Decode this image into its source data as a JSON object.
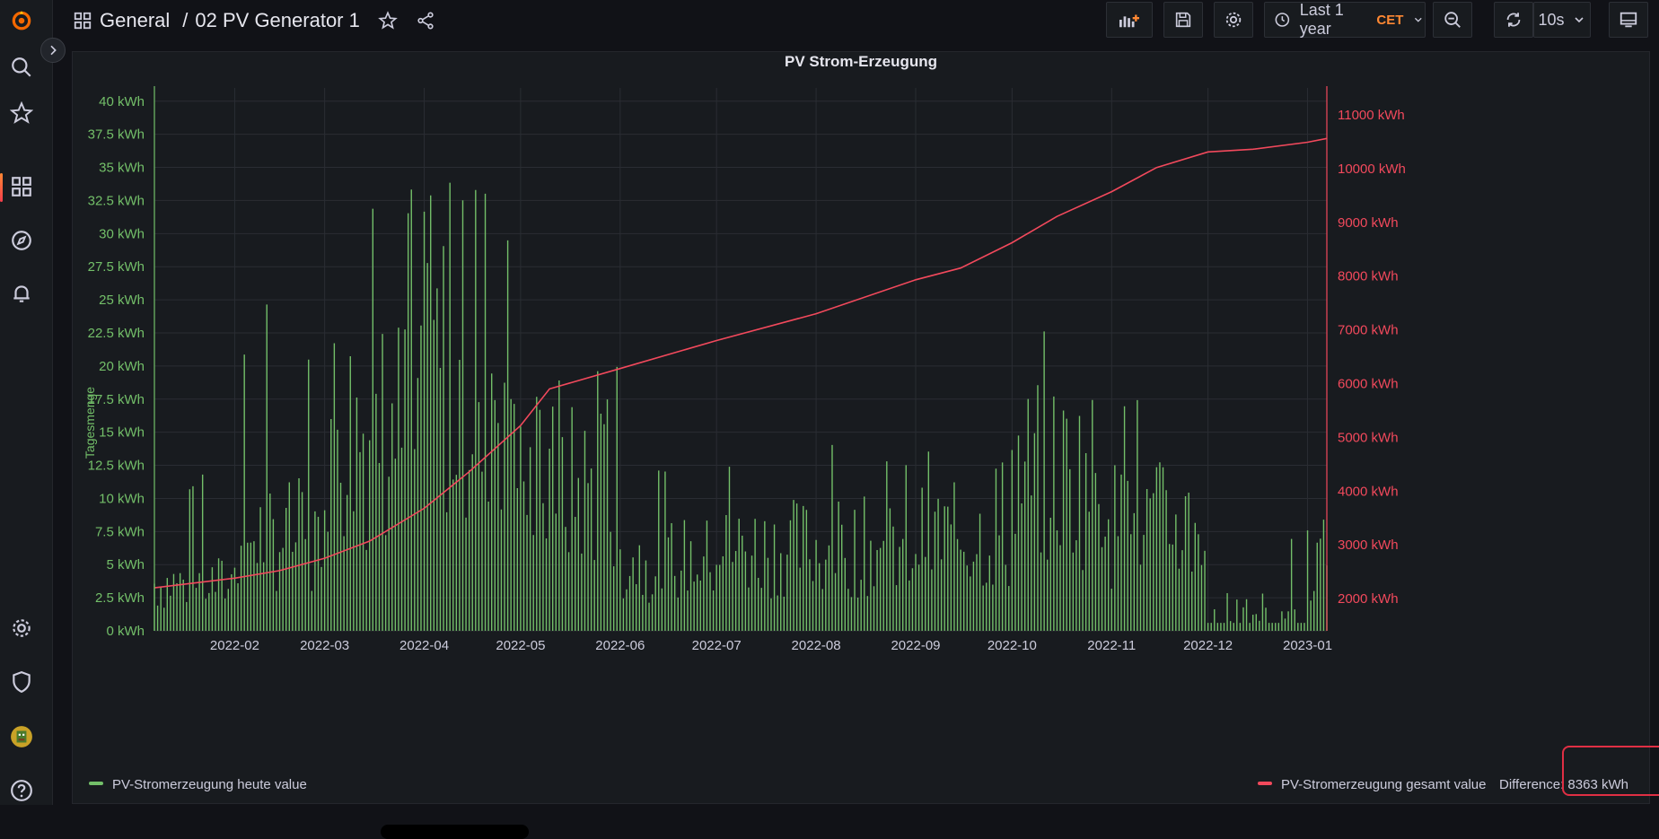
{
  "nav": {
    "breadcrumb_folder": "General",
    "breadcrumb_sep": "/",
    "dashboard_title": "02 PV Generator 1",
    "time_range": "Last 1 year",
    "timezone": "CET",
    "refresh_interval": "10s"
  },
  "panel": {
    "title": "PV Strom-Erzeugung",
    "difference_label": "Difference: 8363 kWh"
  },
  "colors": {
    "daily": "#73bf69",
    "total": "#f2495c",
    "accent": "#ff8833",
    "highlight_box": "#e02f44"
  },
  "chart_data": {
    "type": "bar+line",
    "title": "PV Strom-Erzeugung",
    "x_ticks": [
      "2022-02",
      "2022-03",
      "2022-04",
      "2022-05",
      "2022-06",
      "2022-07",
      "2022-08",
      "2022-09",
      "2022-10",
      "2022-11",
      "2022-12",
      "2023-01"
    ],
    "x_range": [
      "2022-01-07",
      "2023-01-07"
    ],
    "left_axis": {
      "label": "Tagesmenge",
      "unit": "kWh",
      "range": [
        0,
        41
      ],
      "ticks": [
        "0 kWh",
        "2.5 kWh",
        "5 kWh",
        "7.5 kWh",
        "10 kWh",
        "12.5 kWh",
        "15 kWh",
        "17.5 kWh",
        "20 kWh",
        "22.5 kWh",
        "25 kWh",
        "27.5 kWh",
        "30 kWh",
        "32.5 kWh",
        "35 kWh",
        "37.5 kWh",
        "40 kWh"
      ]
    },
    "right_axis": {
      "unit": "kWh",
      "range": [
        1400,
        11500
      ],
      "ticks": [
        "2000 kWh",
        "3000 kWh",
        "4000 kWh",
        "5000 kWh",
        "6000 kWh",
        "7000 kWh",
        "8000 kWh",
        "9000 kWh",
        "10000 kWh",
        "11000 kWh"
      ]
    },
    "series": [
      {
        "name": "PV-Stromerzeugung heute value",
        "type": "bar",
        "axis": "left",
        "monthly_profile": [
          {
            "month": "2022-01",
            "typical_kwh": 4,
            "peak_kwh": 13.7
          },
          {
            "month": "2022-02",
            "typical_kwh": 8,
            "peak_kwh": 25.1
          },
          {
            "month": "2022-03",
            "typical_kwh": 17,
            "peak_kwh": 34.3
          },
          {
            "month": "2022-04",
            "typical_kwh": 22,
            "peak_kwh": 37.0
          },
          {
            "month": "2022-05",
            "typical_kwh": 12,
            "peak_kwh": 20.9
          },
          {
            "month": "2022-06",
            "typical_kwh": 6,
            "peak_kwh": 12.5
          },
          {
            "month": "2022-07",
            "typical_kwh": 7,
            "peak_kwh": 13.5
          },
          {
            "month": "2022-08",
            "typical_kwh": 7,
            "peak_kwh": 15.5
          },
          {
            "month": "2022-09",
            "typical_kwh": 8,
            "peak_kwh": 14.4
          },
          {
            "month": "2022-10",
            "typical_kwh": 13,
            "peak_kwh": 27.7
          },
          {
            "month": "2022-11",
            "typical_kwh": 9,
            "peak_kwh": 22.0
          },
          {
            "month": "2022-12",
            "typical_kwh": 2,
            "peak_kwh": 7.0
          },
          {
            "month": "2023-01",
            "typical_kwh": 6,
            "peak_kwh": 12.0
          }
        ]
      },
      {
        "name": "PV-Stromerzeugung gesamt value",
        "type": "line",
        "axis": "right",
        "x": [
          "2022-01-07",
          "2022-02-01",
          "2022-02-15",
          "2022-03-01",
          "2022-03-15",
          "2022-04-01",
          "2022-04-15",
          "2022-05-01",
          "2022-05-10",
          "2022-06-01",
          "2022-07-01",
          "2022-08-01",
          "2022-09-01",
          "2022-09-15",
          "2022-10-01",
          "2022-10-15",
          "2022-11-01",
          "2022-11-15",
          "2022-12-01",
          "2022-12-15",
          "2023-01-01",
          "2023-01-07"
        ],
        "values": [
          2200,
          2380,
          2520,
          2750,
          3070,
          3680,
          4360,
          5220,
          5900,
          6280,
          6800,
          7300,
          7930,
          8150,
          8620,
          9110,
          9570,
          10020,
          10310,
          10360,
          10490,
          10560
        ]
      }
    ],
    "legend": "bottom",
    "grid": true
  }
}
